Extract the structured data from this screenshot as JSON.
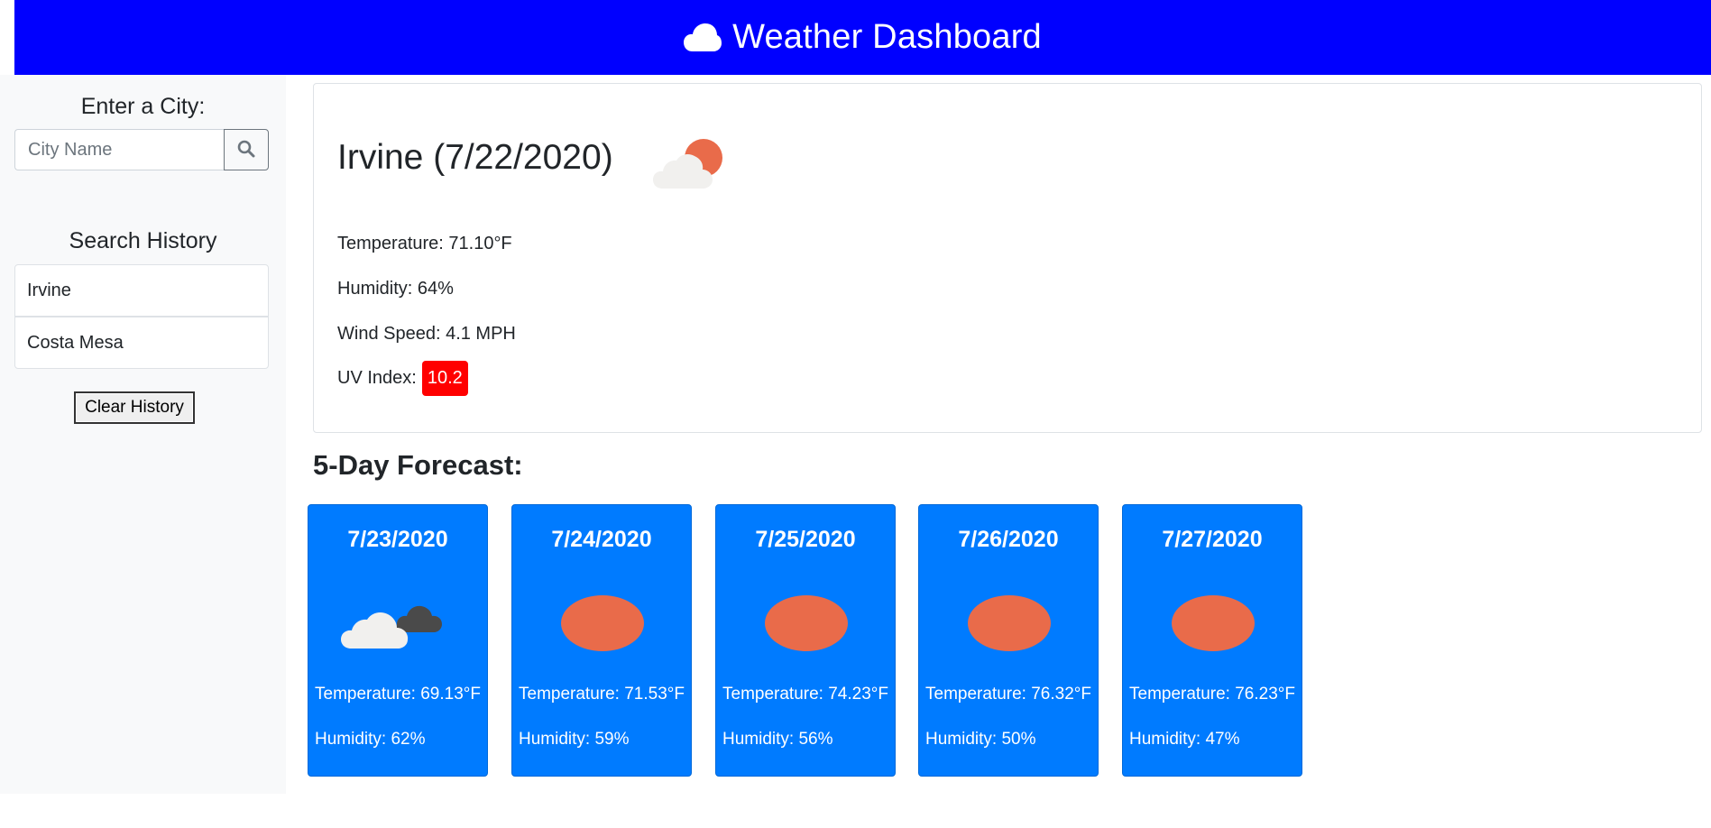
{
  "header": {
    "title": "Weather Dashboard",
    "icon": "cloud-icon",
    "background": "#0000ff"
  },
  "sidebar": {
    "enter_label": "Enter a City:",
    "search": {
      "placeholder": "City Name",
      "value": "",
      "button_icon": "search-icon"
    },
    "history_label": "Search History",
    "history": [
      "Irvine",
      "Costa Mesa"
    ],
    "clear_label": "Clear History"
  },
  "current": {
    "title": "Irvine (7/22/2020)",
    "icon": "partly-cloudy-icon",
    "temperature": "Temperature: 71.10°F",
    "humidity": "Humidity: 64%",
    "wind": "Wind Speed: 4.1 MPH",
    "uv_label": "UV Index:",
    "uv_value": "10.2",
    "uv_color": "#ff0000"
  },
  "forecast": {
    "title": "5-Day Forecast:",
    "card_color": "#007bff",
    "days": [
      {
        "date": "7/23/2020",
        "icon": "cloudy-icon",
        "temperature": "Temperature: 69.13°F",
        "humidity": "Humidity: 62%"
      },
      {
        "date": "7/24/2020",
        "icon": "sun-icon",
        "temperature": "Temperature: 71.53°F",
        "humidity": "Humidity: 59%"
      },
      {
        "date": "7/25/2020",
        "icon": "sun-icon",
        "temperature": "Temperature: 74.23°F",
        "humidity": "Humidity: 56%"
      },
      {
        "date": "7/26/2020",
        "icon": "sun-icon",
        "temperature": "Temperature: 76.32°F",
        "humidity": "Humidity: 50%"
      },
      {
        "date": "7/27/2020",
        "icon": "sun-icon",
        "temperature": "Temperature: 76.23°F",
        "humidity": "Humidity: 47%"
      }
    ]
  }
}
